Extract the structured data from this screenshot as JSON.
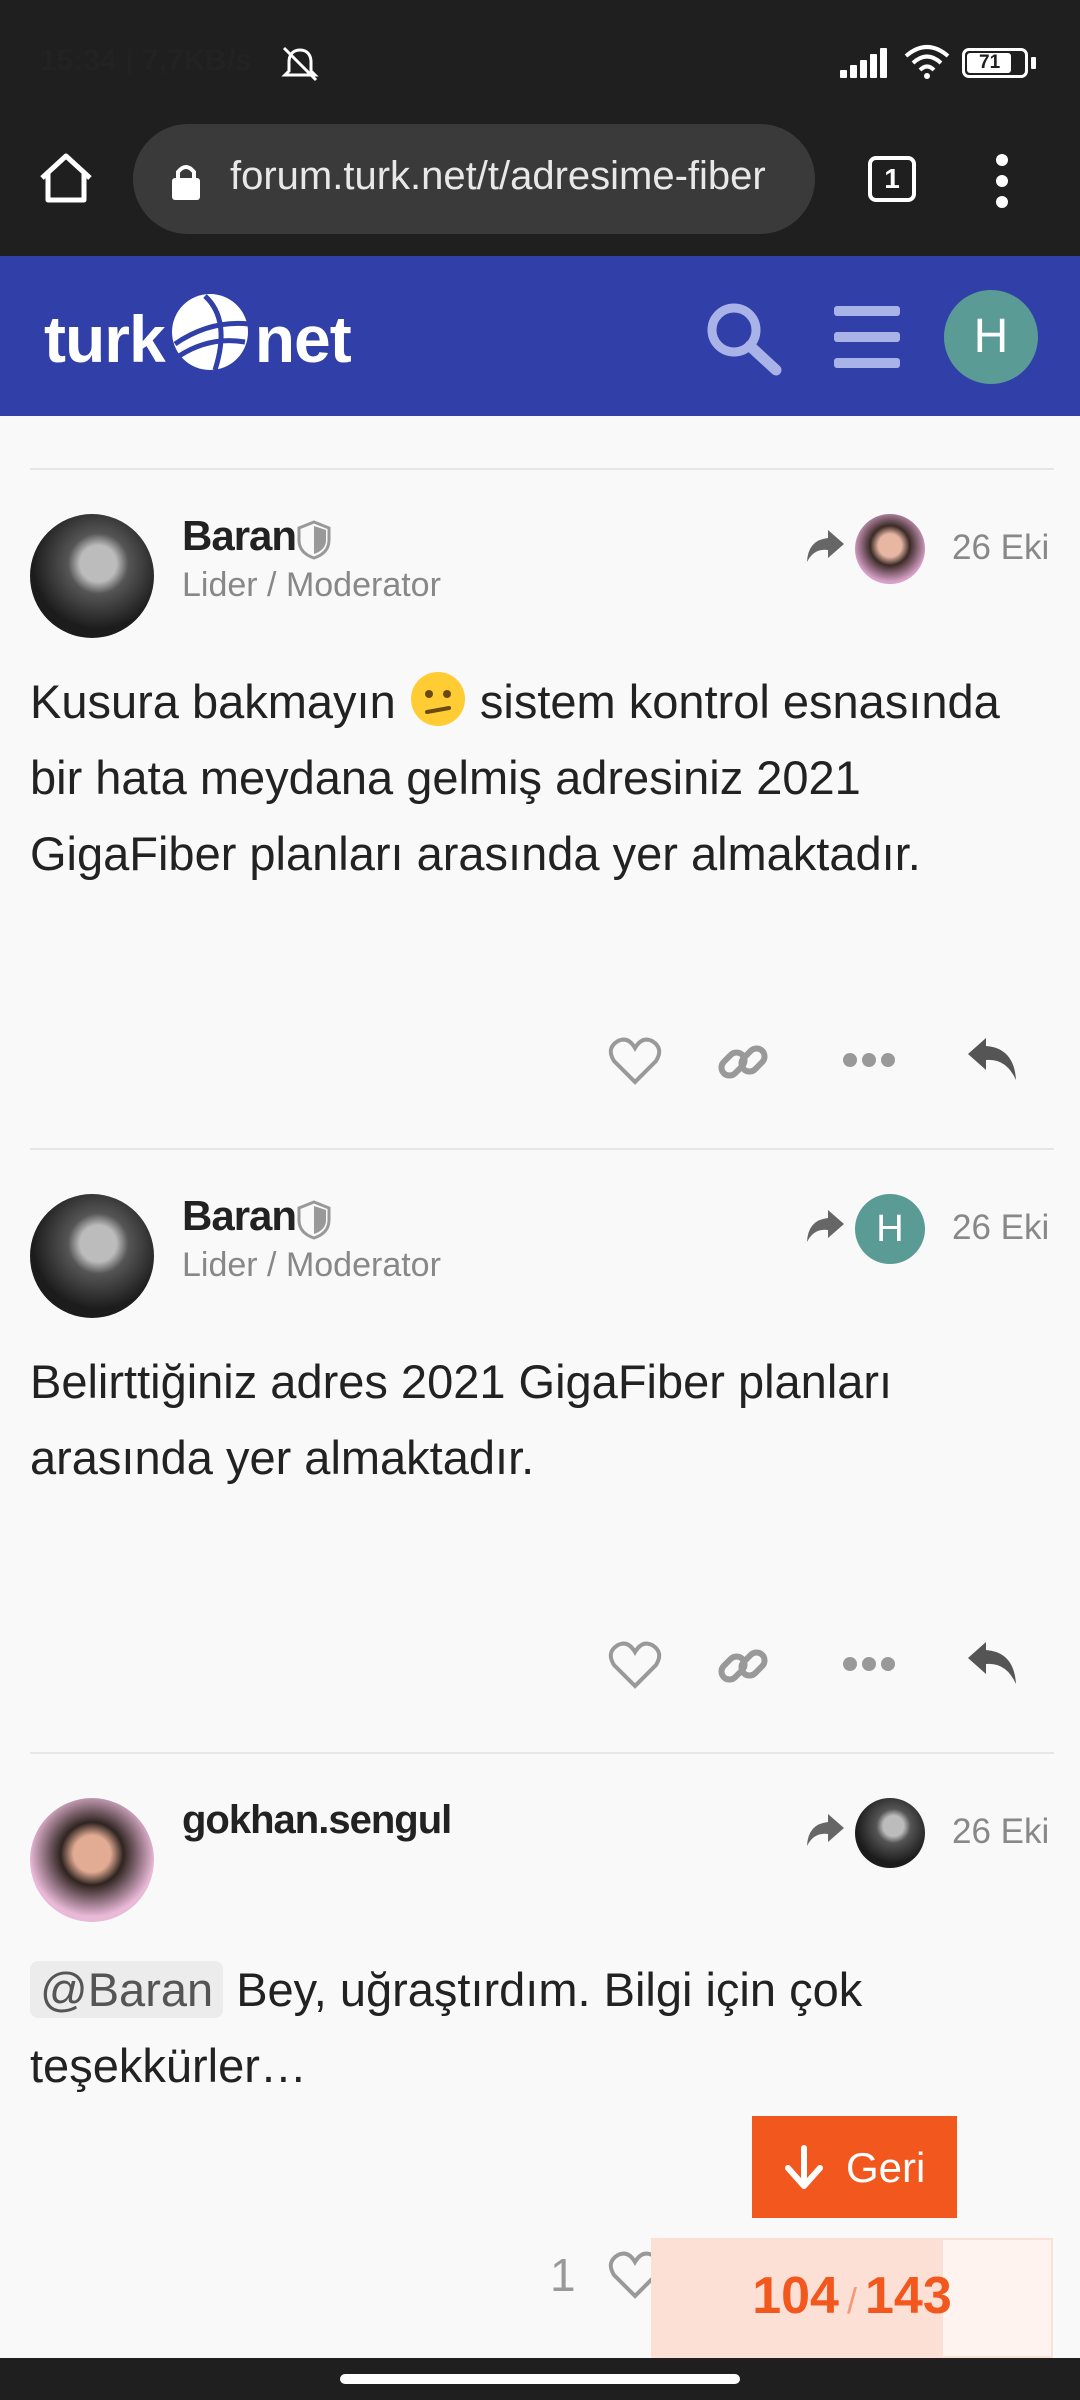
{
  "status_bar": {
    "time": "15:34 | 7,7KB/s",
    "battery": "71"
  },
  "browser": {
    "url": "forum.turk.net/t/adresime-fiber",
    "tab_count": "1"
  },
  "site": {
    "logo_left": "turk",
    "logo_right": "net",
    "user_initial": "H"
  },
  "posts": [
    {
      "username": "Baran",
      "title": "Lider / Moderator",
      "reply_to_initial": "",
      "date": "26 Eki",
      "body_before_emoji": "Kusura bakmayın ",
      "body_after_emoji": " sistem kontrol esnasında bir hata meydana gelmiş adresiniz 2021 GigaFiber planları arasında yer almaktadır."
    },
    {
      "username": "Baran",
      "title": "Lider / Moderator",
      "reply_to_initial": "H",
      "date": "26 Eki",
      "body": "Belirttiğiniz adres 2021 GigaFiber planları arasında yer almaktadır."
    },
    {
      "username": "gokhan.sengul",
      "date": "26 Eki",
      "mention": "@Baran",
      "body": " Bey, uğraştırdım. Bilgi için çok teşekkürler…",
      "like_count": "1"
    }
  ],
  "geri_label": "Geri",
  "progress": {
    "current": "104",
    "separator": "/",
    "total": "143",
    "fraction": 0.727
  },
  "colors": {
    "header": "#3040a8",
    "accent": "#f2571e",
    "avatar_h": "#5a9c95"
  }
}
